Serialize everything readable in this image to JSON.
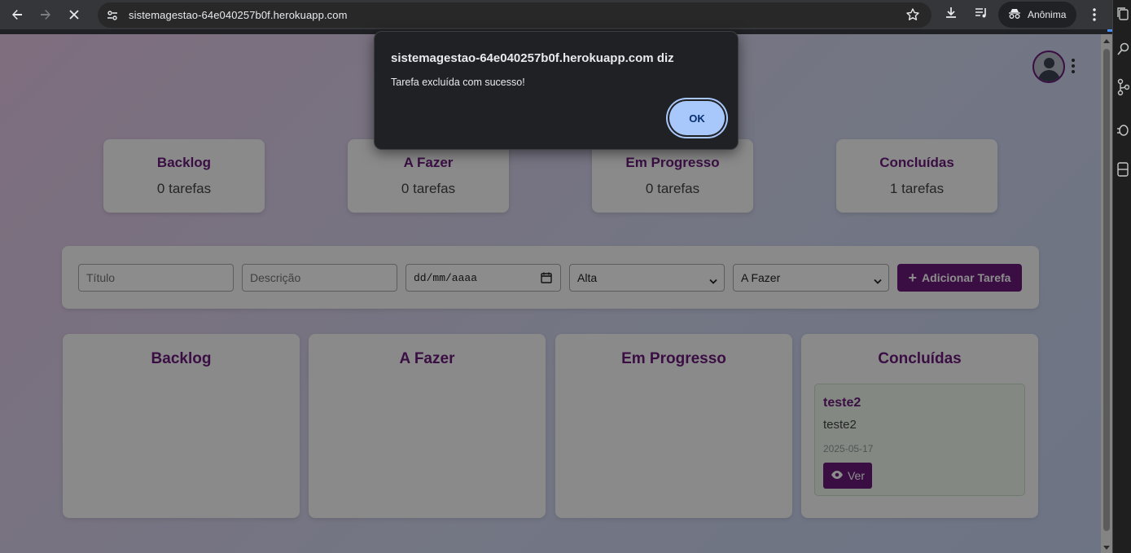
{
  "browser": {
    "url": "sistemagestao-64e040257b0f.herokuapp.com",
    "profile_label": "Anônima",
    "icons": [
      "back-icon",
      "forward-icon",
      "stop-icon",
      "site-info-icon",
      "star-icon",
      "download-icon",
      "media-icon",
      "incognito-icon",
      "kebab-icon"
    ]
  },
  "dialog": {
    "title": "sistemagestao-64e040257b0f.herokuapp.com diz",
    "message": "Tarefa excluída com sucesso!",
    "ok_label": "OK"
  },
  "stats": [
    {
      "title": "Backlog",
      "count": "0 tarefas"
    },
    {
      "title": "A Fazer",
      "count": "0 tarefas"
    },
    {
      "title": "Em Progresso",
      "count": "0 tarefas"
    },
    {
      "title": "Concluídas",
      "count": "1 tarefas"
    }
  ],
  "form": {
    "title_placeholder": "Título",
    "description_placeholder": "Descrição",
    "date_value": "dd/mm/aaaa",
    "priority_value": "Alta",
    "status_value": "A Fazer",
    "add_label": "Adicionar Tarefa"
  },
  "columns": [
    {
      "title": "Backlog"
    },
    {
      "title": "A Fazer"
    },
    {
      "title": "Em Progresso"
    },
    {
      "title": "Concluídas"
    }
  ],
  "task": {
    "title": "teste2",
    "description": "teste2",
    "date": "2025-05-17",
    "view_label": "Ver"
  },
  "colors": {
    "accent": "#6a1b7a",
    "dialog_bg": "#202124",
    "ok_button": "#a8c7fa"
  }
}
